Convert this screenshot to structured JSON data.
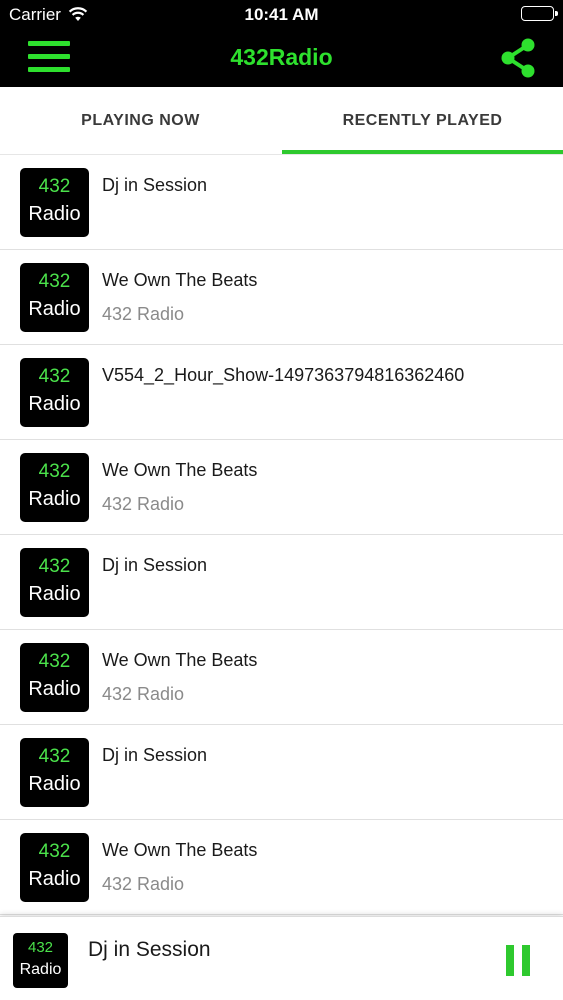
{
  "status_bar": {
    "carrier": "Carrier",
    "time": "10:41 AM"
  },
  "nav": {
    "title": "432Radio",
    "menu_icon": "hamburger-menu-icon",
    "share_icon": "share-icon"
  },
  "tabs": [
    {
      "label": "PLAYING NOW",
      "selected": false
    },
    {
      "label": "RECENTLY PLAYED",
      "selected": true
    }
  ],
  "logo": {
    "number": "432",
    "word": "Radio"
  },
  "recently_played": [
    {
      "title": "Dj in Session",
      "subtitle": ""
    },
    {
      "title": "We Own The Beats",
      "subtitle": "432 Radio"
    },
    {
      "title": "V554_2_Hour_Show-1497363794816362460",
      "subtitle": ""
    },
    {
      "title": "We Own The Beats",
      "subtitle": "432 Radio"
    },
    {
      "title": "Dj in Session",
      "subtitle": ""
    },
    {
      "title": "We Own The Beats",
      "subtitle": "432 Radio"
    },
    {
      "title": "Dj in Session",
      "subtitle": ""
    },
    {
      "title": "We Own The Beats",
      "subtitle": "432 Radio"
    }
  ],
  "player": {
    "title": "Dj in Session",
    "control_icon": "pause-icon"
  },
  "colors": {
    "accent": "#2ec92e",
    "bar_background": "#000000"
  }
}
